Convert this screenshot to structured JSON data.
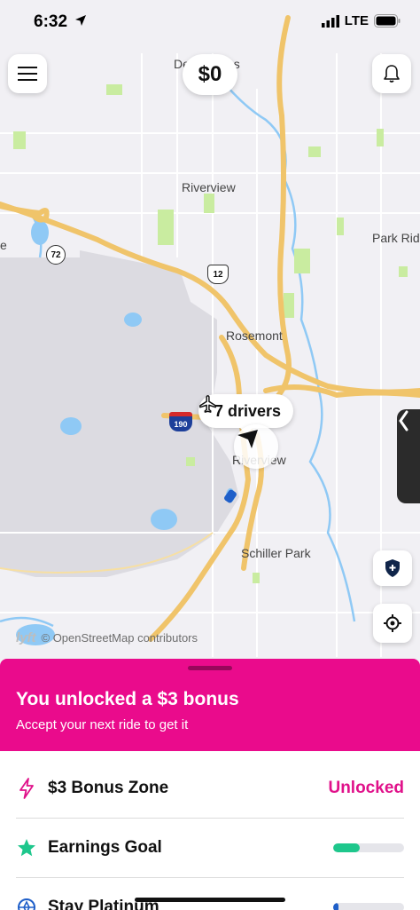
{
  "status": {
    "time": "6:32",
    "network": "LTE"
  },
  "header": {
    "menu_icon": "hamburger-icon",
    "earnings": "$0",
    "notifications_icon": "bell-icon"
  },
  "map": {
    "labels": {
      "des_plaines": "Des Plaines",
      "riverview_north": "Riverview",
      "park_ridge": "Park Rid",
      "rosemont": "Rosemont",
      "riverview_center": "Riverview",
      "schiller_park": "Schiller Park",
      "route_72": "72",
      "route_12": "12",
      "route_190": "190",
      "edge_letter": "e"
    },
    "drivers_pill": {
      "icon": "airplane-icon",
      "text": "7 drivers"
    },
    "attribution": {
      "logo": "lyft",
      "text": "© OpenStreetMap contributors"
    },
    "colors": {
      "land": "#f1f0f4",
      "water": "#8fc9f5",
      "park": "#c9eca0",
      "highway": "#f0c46a",
      "airport": "#dcdbe1"
    }
  },
  "controls": {
    "safety_icon": "shield-plus-icon",
    "recenter_icon": "crosshair-icon",
    "side_panel_icon": "chevron-left-icon"
  },
  "bonus": {
    "title": "You unlocked a $3 bonus",
    "subtitle": "Accept your next ride to get it",
    "color": "#ea0b8c"
  },
  "list": {
    "bonus_zone": {
      "label": "$3 Bonus Zone",
      "value": "Unlocked",
      "icon": "lightning-icon"
    },
    "earnings_goal": {
      "label": "Earnings Goal",
      "progress": 0.38,
      "icon": "star-icon",
      "color": "#1ec78c"
    },
    "stay_platinum": {
      "label": "Stay Platinum",
      "icon": "platinum-badge-icon",
      "color": "#1f5fc9"
    }
  }
}
